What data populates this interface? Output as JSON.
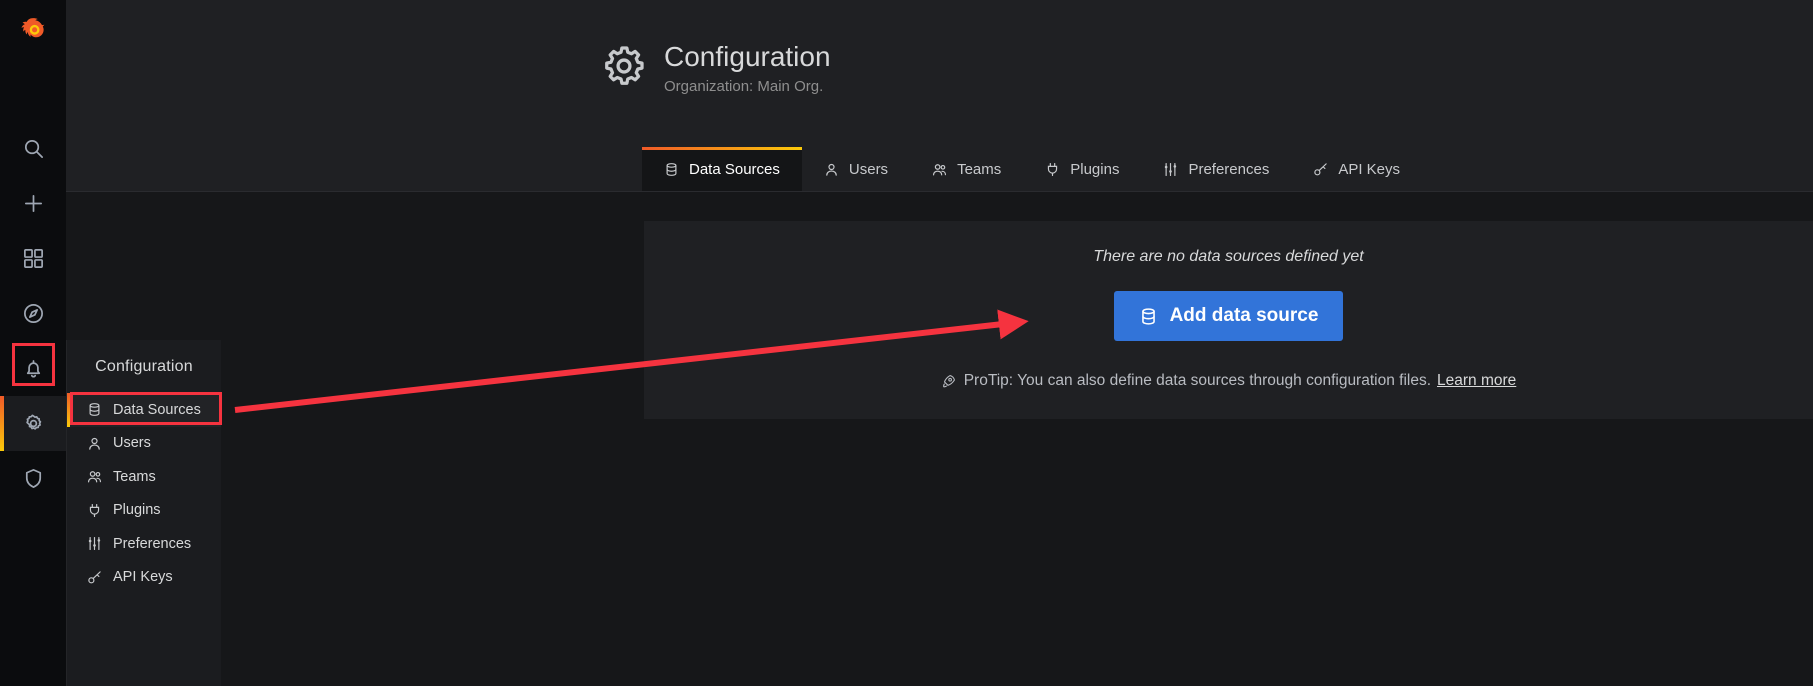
{
  "rail": {
    "logo_name": "grafana-logo",
    "items": [
      {
        "name": "search-icon",
        "label": "Search"
      },
      {
        "name": "plus-icon",
        "label": "Create"
      },
      {
        "name": "dashboards-icon",
        "label": "Dashboards"
      },
      {
        "name": "explore-icon",
        "label": "Explore"
      },
      {
        "name": "bell-icon",
        "label": "Alerting"
      },
      {
        "name": "gear-icon",
        "label": "Configuration"
      },
      {
        "name": "shield-icon",
        "label": "Server Admin"
      }
    ]
  },
  "flyout": {
    "title": "Configuration",
    "items": [
      {
        "label": "Data Sources",
        "icon": "database-icon",
        "active": true
      },
      {
        "label": "Users",
        "icon": "user-icon",
        "active": false
      },
      {
        "label": "Teams",
        "icon": "users-icon",
        "active": false
      },
      {
        "label": "Plugins",
        "icon": "plug-icon",
        "active": false
      },
      {
        "label": "Preferences",
        "icon": "sliders-icon",
        "active": false
      },
      {
        "label": "API Keys",
        "icon": "key-icon",
        "active": false
      }
    ]
  },
  "header": {
    "icon": "gear-icon",
    "title": "Configuration",
    "subtitle": "Organization: Main Org."
  },
  "tabs": [
    {
      "label": "Data Sources",
      "icon": "database-icon",
      "active": true
    },
    {
      "label": "Users",
      "icon": "user-icon",
      "active": false
    },
    {
      "label": "Teams",
      "icon": "users-icon",
      "active": false
    },
    {
      "label": "Plugins",
      "icon": "plug-icon",
      "active": false
    },
    {
      "label": "Preferences",
      "icon": "sliders-icon",
      "active": false
    },
    {
      "label": "API Keys",
      "icon": "key-icon",
      "active": false
    }
  ],
  "content": {
    "empty_message": "There are no data sources defined yet",
    "add_button_label": "Add data source",
    "add_button_icon": "database-icon",
    "protip_icon": "rocket-icon",
    "protip_text": "ProTip: You can also define data sources through configuration files.",
    "protip_link": "Learn more"
  },
  "colors": {
    "accent_start": "#f05a28",
    "accent_end": "#fbca0a",
    "primary_button": "#3274d9",
    "annotation": "#f5333f",
    "panel_bg": "#1f2023",
    "page_bg": "#161719",
    "rail_bg": "#0b0c0e"
  }
}
